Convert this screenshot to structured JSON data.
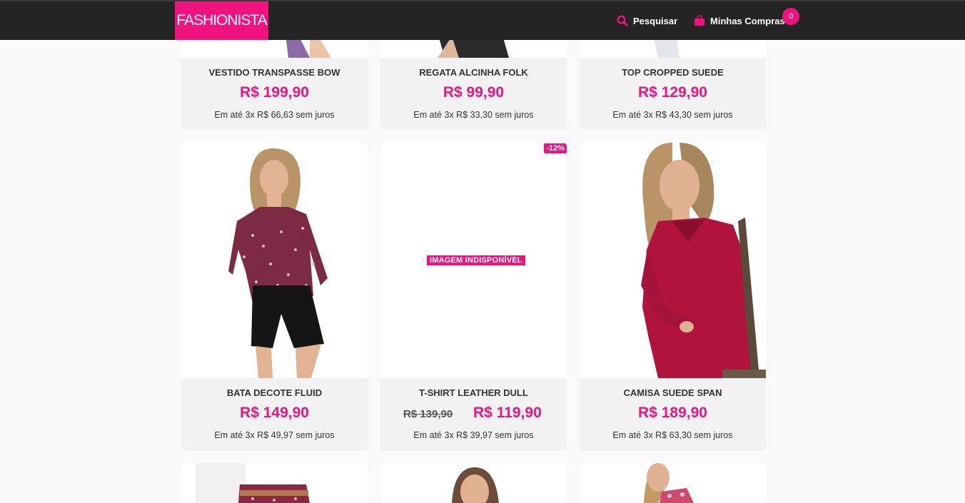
{
  "header": {
    "logo": "FASHIONISTA",
    "search_label": "Pesquisar",
    "cart_label": "Minhas Compras",
    "cart_count": "0",
    "icons": {
      "search": "search-icon",
      "cart": "shopping-bag-icon"
    }
  },
  "colors": {
    "accent": "#f0127f",
    "header_bg": "#242424",
    "page_bg": "#f9f9f9"
  },
  "products": [
    {
      "name": "VESTIDO TRANSPASSE BOW",
      "price": "R$ 199,90",
      "installments": "Em até 3x R$ 66,63 sem juros"
    },
    {
      "name": "REGATA ALCINHA FOLK",
      "price": "R$ 99,90",
      "installments": "Em até 3x R$ 33,30 sem juros"
    },
    {
      "name": "TOP CROPPED SUEDE",
      "price": "R$ 129,90",
      "installments": "Em até 3x R$ 43,30 sem juros"
    },
    {
      "name": "BATA DECOTE FLUID",
      "price": "R$ 149,90",
      "installments": "Em até 3x R$ 49,97 sem juros"
    },
    {
      "name": "T-SHIRT LEATHER DULL",
      "old_price": "R$ 139,90",
      "price": "R$ 119,90",
      "installments": "Em até 3x R$ 39,97 sem juros",
      "discount": "-12%",
      "image_unavailable": "IMAGEM INDISPONÍVEL"
    },
    {
      "name": "CAMISA SUEDE SPAN",
      "price": "R$ 189,90",
      "installments": "Em até 3x R$ 63,30 sem juros"
    }
  ]
}
